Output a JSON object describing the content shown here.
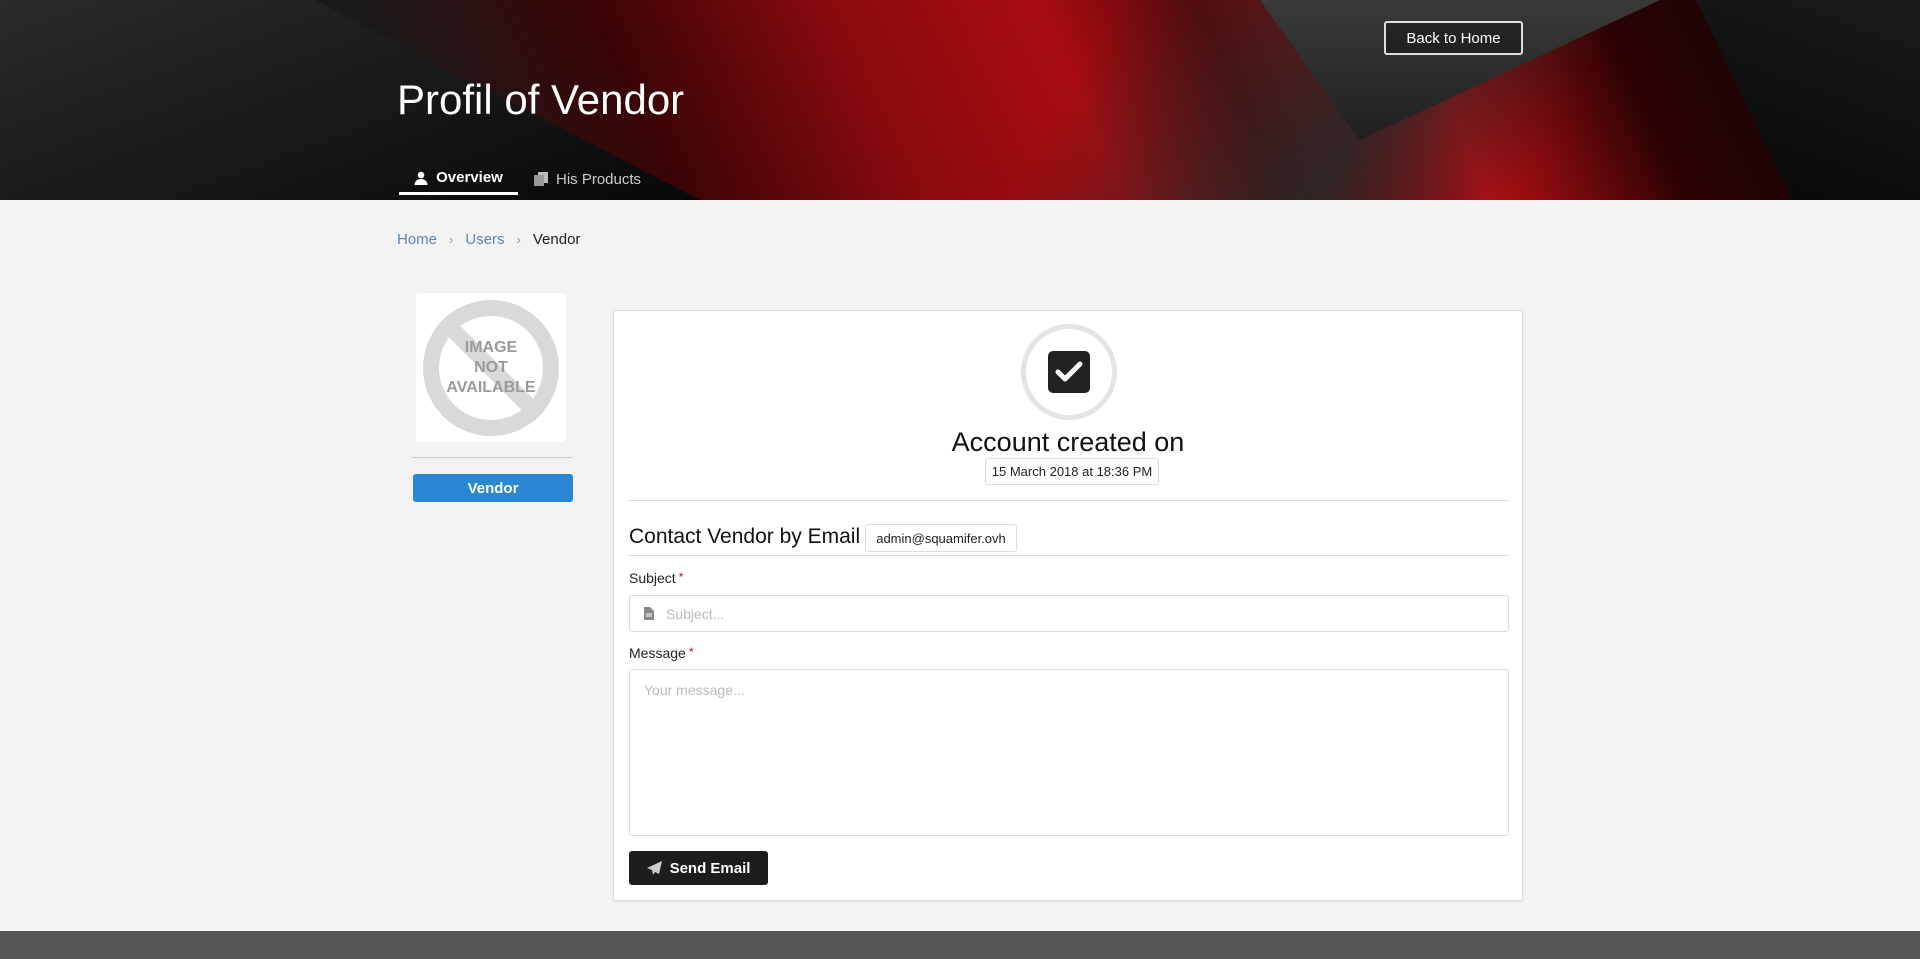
{
  "header": {
    "title": "Profil of Vendor",
    "back_button": "Back to Home",
    "tabs": [
      {
        "label": "Overview",
        "icon": "user-icon",
        "active": true
      },
      {
        "label": "His Products",
        "icon": "copy-icon",
        "active": false
      }
    ]
  },
  "breadcrumb": [
    "Home",
    "Users",
    "Vendor"
  ],
  "sidebar": {
    "image_text": [
      "IMAGE",
      "NOT",
      "AVAILABLE"
    ],
    "role_button": "Vendor",
    "role_color": "#2a87d3"
  },
  "card": {
    "account_label": "Account created on",
    "created_date": "15 March 2018 at 18:36 PM",
    "contact_heading": "Contact Vendor by Email",
    "email": "admin@squamifer.ovh",
    "subject_label": "Subject",
    "subject_placeholder": "Subject...",
    "message_label": "Message",
    "message_placeholder": "Your message...",
    "required_mark": "*",
    "send_button": "Send Email"
  }
}
